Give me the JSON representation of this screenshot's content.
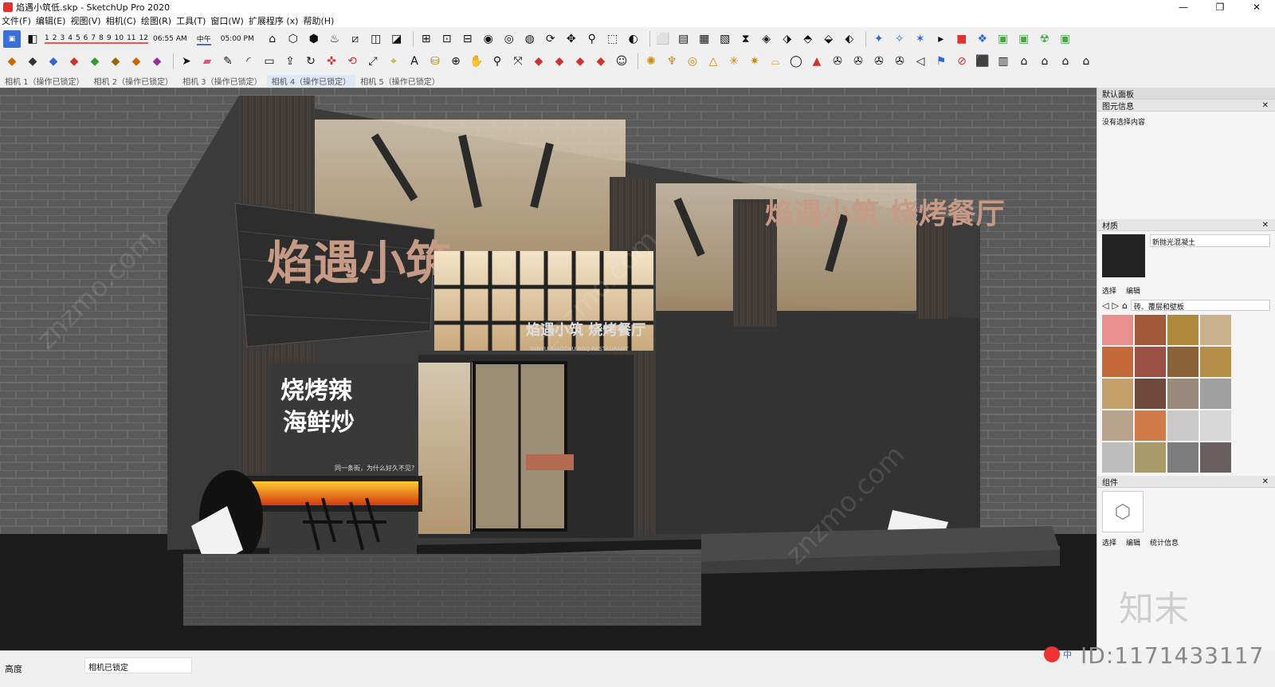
{
  "window": {
    "title": "焰遇小筑低.skp - SketchUp Pro 2020"
  },
  "menu": [
    "文件(F)",
    "编辑(E)",
    "视图(V)",
    "相机(C)",
    "绘图(R)",
    "工具(T)",
    "窗口(W)",
    "扩展程序 (x)",
    "帮助(H)"
  ],
  "shadow": {
    "months": [
      "1",
      "2",
      "3",
      "4",
      "5",
      "6",
      "7",
      "8",
      "9",
      "10",
      "11",
      "12"
    ],
    "time_start": "06:55 AM",
    "noon": "中午",
    "time_end": "05:00 PM"
  },
  "scenes": [
    "相机 1（操作已锁定）",
    "相机 2（操作已锁定）",
    "相机 3（操作已锁定）",
    "相机 4（操作已锁定）",
    "相机 5（操作已锁定）"
  ],
  "scene_active": 3,
  "viewport": {
    "sign_main": "焰遇小筑",
    "sign_upper": "焰遇小筑 烧烤餐厅",
    "sign_bbq": "烧烤辣",
    "sign_seafood": "海鲜炒",
    "sign_small": "同一条街，为什么好久不见？",
    "sign_door": "焰遇小筑 烧烤餐厅",
    "sign_door_en": "YANYU XIAOZHU BBQ RESTAURANT"
  },
  "status": {
    "label": "高度",
    "vcb_value": "相机已锁定"
  },
  "panel": {
    "title": "默认面板",
    "entity_info": {
      "title": "图元信息",
      "empty": "没有选择内容"
    },
    "materials": {
      "title": "材质",
      "name": "新抛光混凝土",
      "tab_select": "选择",
      "tab_edit": "编辑",
      "library": "砖、覆层和壁板"
    },
    "components": {
      "title": "组件",
      "tab_select": "选择",
      "tab_edit": "编辑",
      "tab_stats": "统计信息"
    }
  },
  "watermark": {
    "id": "ID:1171433117",
    "brand": "知末"
  },
  "tray": {
    "ime": "中"
  },
  "colors": {
    "accent": "#d33",
    "sign": "#e87a3a"
  }
}
